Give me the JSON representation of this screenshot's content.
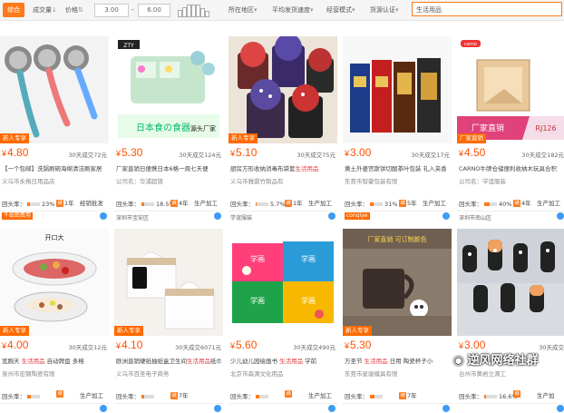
{
  "filters": {
    "integrated": "综合",
    "deals": "成交量",
    "price": "价格",
    "price_min": "3.00",
    "price_sep": "-",
    "price_max": "6.00",
    "location": "所在地区",
    "ship_speed": "平均发货速度",
    "biz_mode": "经营模式",
    "cert": "货源认证",
    "search_value": "生活用品"
  },
  "colors": {
    "accent": "#ff7a1a",
    "price": "#ff5000",
    "badge": "#ff6a00"
  },
  "products": [
    {
      "img": "sponge-brushes",
      "badge": "新人专享",
      "price": "4.80",
      "sold": "30天成交72元",
      "title_a": "【一个包邮】洗锅刷碗海绵清洁刷家居",
      "title_b": "",
      "title_c": "",
      "supplier": "义乌市永格日用品店",
      "rate_label": "回头率：",
      "rate_pct": "23%",
      "rate_frac": 0.23,
      "years": "1年",
      "mode": "经销批发",
      "bottom_tag": "千纸鹤费用",
      "bottom_tag_highlight": true
    },
    {
      "img": "pill-box",
      "badge": "",
      "price": "5.30",
      "sold": "30天成交124元",
      "title_a": "厂家直销日便携日本6格一周七天便",
      "title_b": "",
      "title_c": "",
      "supplier": "公司名：华浦超镁",
      "rate_label": "回头率：",
      "rate_pct": "18.5%",
      "rate_frac": 0.185,
      "years": "4年",
      "mode": "生产加工",
      "bottom_tag": "深圳市宝安区",
      "bottom_tag_highlight": false
    },
    {
      "img": "socks",
      "badge": "新人专享",
      "price": "5.10",
      "sold": "30天成交75元",
      "title_a": "厨房方形收纳消毒布袋套",
      "title_b": "生活用品",
      "title_c": "",
      "supplier": "义乌市雅鼎竹制品有",
      "rate_label": "回头率：",
      "rate_pct": "5.7%",
      "rate_frac": 0.057,
      "years": "1年",
      "mode": "生产加工",
      "bottom_tag": "学谊服装",
      "bottom_tag_highlight": false
    },
    {
      "img": "tea-boxes",
      "badge": "",
      "price": "3.00",
      "sold": "30天成交17元",
      "title_a": "黄土外婆宫斯饼切酸茶叶包装 礼入夹香",
      "title_b": "",
      "title_c": "",
      "supplier": "东莞市智豪包装有限",
      "rate_label": "回头率：",
      "rate_pct": "31%",
      "rate_frac": 0.31,
      "years": "5年",
      "mode": "生产加工",
      "bottom_tag": "conqiye",
      "bottom_tag_highlight": true
    },
    {
      "img": "wooden-box",
      "badge": "厂家直销",
      "price": "4.50",
      "sold": "30天成交182元",
      "title_a": "CARNO牛牌仓储便利收纳木玩具合积",
      "title_b": "",
      "title_c": "",
      "supplier": "公司名：学谊服装",
      "rate_label": "回头率：",
      "rate_pct": "40%",
      "rate_frac": 0.4,
      "years": "4年",
      "mode": "生产加工",
      "bottom_tag": "深圳市南山区",
      "bottom_tag_highlight": false
    },
    {
      "img": "fruit-tray",
      "badge": "新人专享",
      "price": "4.00",
      "sold": "30天成交12元",
      "title_a": "宽腕天 ",
      "title_b": "生活用品",
      "title_c": " 自动牌盘 多格",
      "supplier": "泉州市宏钢陶瓷有限",
      "rate_label": "回头率：",
      "rate_pct": "",
      "rate_frac": 0.3,
      "years": "",
      "mode": "生产加工",
      "bottom_tag": "",
      "bottom_tag_highlight": false
    },
    {
      "img": "tissue-box",
      "badge": "新人专享",
      "price": "4.10",
      "sold": "30天成交6071元",
      "title_a": "欧洲直销硬纸抽纸盒卫生间",
      "title_b": "生活用品",
      "title_c": "纸巾架",
      "supplier": "义乌市百圣电子商务",
      "rate_label": "回头率：",
      "rate_pct": "",
      "rate_frac": 0.2,
      "years": "7年",
      "mode": "",
      "bottom_tag": "",
      "bottom_tag_highlight": false
    },
    {
      "img": "books",
      "badge": "",
      "price": "5.60",
      "sold": "30天成交490元",
      "title_a": "少儿幼儿园绘画书 ",
      "title_b": "生活用品",
      "title_c": " 学前",
      "supplier": "北京市森源文化用品",
      "rate_label": "回头率：",
      "rate_pct": "",
      "rate_frac": 0.25,
      "years": "",
      "mode": "生产加工",
      "bottom_tag": "",
      "bottom_tag_highlight": false
    },
    {
      "img": "mug",
      "badge": "新人专享",
      "price": "5.30",
      "sold": "",
      "title_a": "万圣节 ",
      "title_b": "生活用品",
      "title_c": " 日用 陶瓷杯子小",
      "supplier": "东莞市星骏模具有限",
      "rate_label": "回头率：",
      "rate_pct": "",
      "rate_frac": 0.35,
      "years": "7年",
      "mode": "",
      "bottom_tag": "",
      "bottom_tag_highlight": false
    },
    {
      "img": "cat-hooks",
      "badge": "",
      "price": "3.00",
      "sold": "30天成交",
      "title_a": "",
      "title_b": "",
      "title_c": "",
      "supplier": "台州市黄岩立源工",
      "rate_label": "回头率：",
      "rate_pct": "16.6%",
      "rate_frac": 0.166,
      "years": "",
      "mode": "生产加",
      "bottom_tag": "",
      "bottom_tag_highlight": false
    }
  ],
  "watermark": {
    "icon": "wechat-icon",
    "text": "逆风网络社群"
  }
}
